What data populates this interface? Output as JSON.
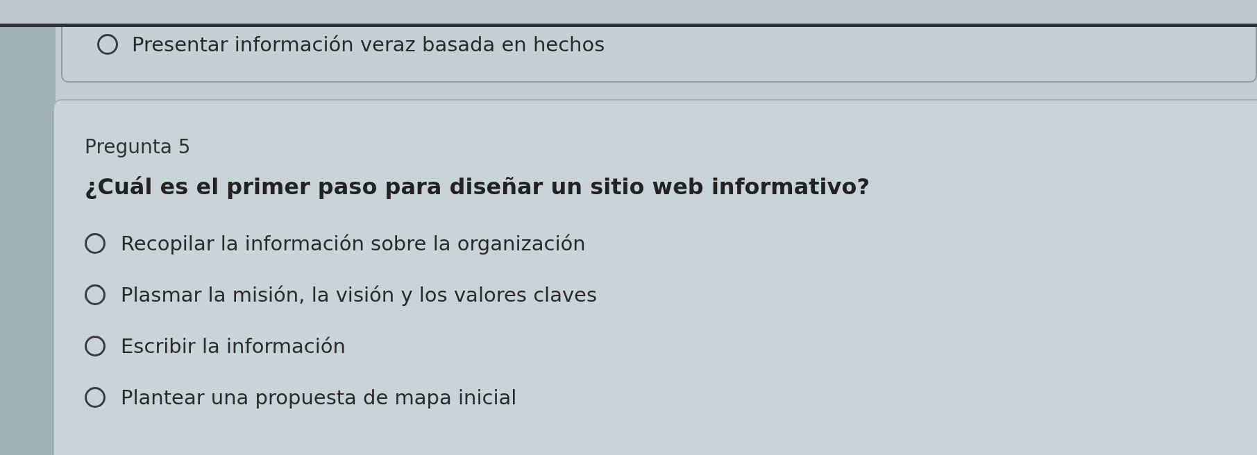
{
  "previous_question": {
    "options": [
      {
        "label": "Presentar información veraz basada en hechos",
        "selected": false
      }
    ]
  },
  "question": {
    "number": "Pregunta 5",
    "text": "¿Cuál es el primer paso para diseñar un sitio web informativo?",
    "options": [
      {
        "label": "Recopilar la información sobre la organización",
        "selected": false
      },
      {
        "label": "Plasmar la misión, la visión y los valores claves",
        "selected": false
      },
      {
        "label": "Escribir la información",
        "selected": false
      },
      {
        "label": "Plantear una propuesta de mapa inicial",
        "selected": false
      }
    ]
  }
}
